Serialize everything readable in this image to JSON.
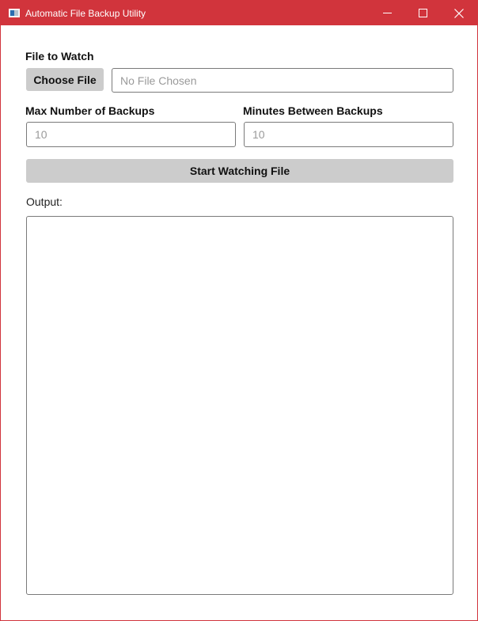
{
  "window": {
    "title": "Automatic File Backup Utility",
    "accent_color": "#d1343c",
    "icons": [
      "app-icon",
      "minimize-icon",
      "maximize-icon",
      "close-icon"
    ]
  },
  "form": {
    "file_label": "File to Watch",
    "choose_file_label": "Choose File",
    "file_placeholder": "No File Chosen",
    "max_backups_label": "Max Number of Backups",
    "max_backups_placeholder": "10",
    "minutes_label": "Minutes Between Backups",
    "minutes_placeholder": "10",
    "start_label": "Start Watching File"
  },
  "output": {
    "label": "Output:",
    "text": ""
  }
}
